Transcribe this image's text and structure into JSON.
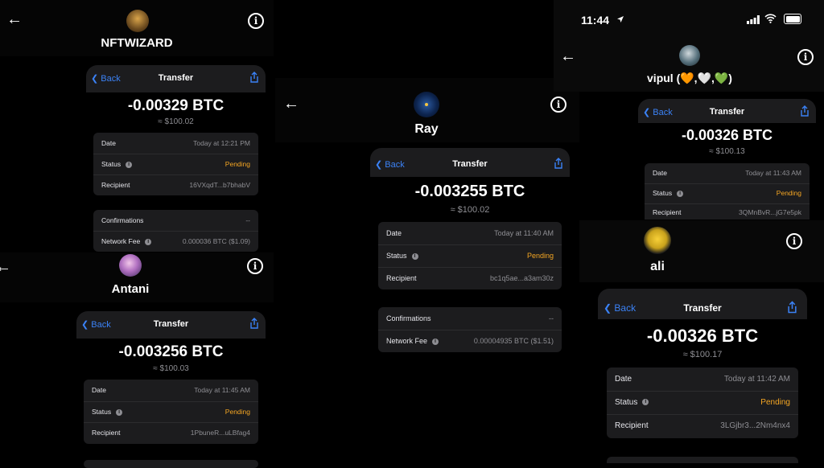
{
  "status_bar": {
    "time": "11:44",
    "location_icon": "location-arrow-icon",
    "icons": [
      "signal-icon",
      "wifi-icon",
      "battery-icon"
    ]
  },
  "labels": {
    "back": "Back",
    "transfer": "Transfer",
    "date": "Date",
    "status": "Status",
    "recipient": "Recipient",
    "confirmations": "Confirmations",
    "network_fee": "Network Fee"
  },
  "colors": {
    "accent": "#3b82f6",
    "pending": "#f5a623",
    "background": "#000000",
    "panel": "#1c1c1e"
  },
  "screens": [
    {
      "name": "NFTWIZARD",
      "amount": "-0.00329 BTC",
      "usd": "≈ $100.02",
      "date": "Today at 12:21 PM",
      "status": "Pending",
      "recipient": "16VXqdT...b7bhabV",
      "confirmations": "--",
      "network_fee": "0.000036 BTC ($1.09)"
    },
    {
      "name": "Antani",
      "amount": "-0.003256 BTC",
      "usd": "≈ $100.03",
      "date": "Today at 11:45 AM",
      "status": "Pending",
      "recipient": "1PbuneR...uLBfag4"
    },
    {
      "name": "Ray",
      "amount": "-0.003255 BTC",
      "usd": "≈ $100.02",
      "date": "Today at 11:40 AM",
      "status": "Pending",
      "recipient": "bc1q5ae...a3am30z",
      "confirmations": "--",
      "network_fee": "0.00004935 BTC ($1.51)"
    },
    {
      "name": "vipul (🧡,🤍,💚)",
      "amount": "-0.00326 BTC",
      "usd": "≈ $100.13",
      "date": "Today at 11:43 AM",
      "status": "Pending",
      "recipient": "3QMnBvR...jG7e5pk"
    },
    {
      "name": "ali",
      "amount": "-0.00326 BTC",
      "usd": "≈ $100.17",
      "date": "Today at 11:42 AM",
      "status": "Pending",
      "recipient": "3LGjbr3...2Nm4nx4"
    }
  ]
}
